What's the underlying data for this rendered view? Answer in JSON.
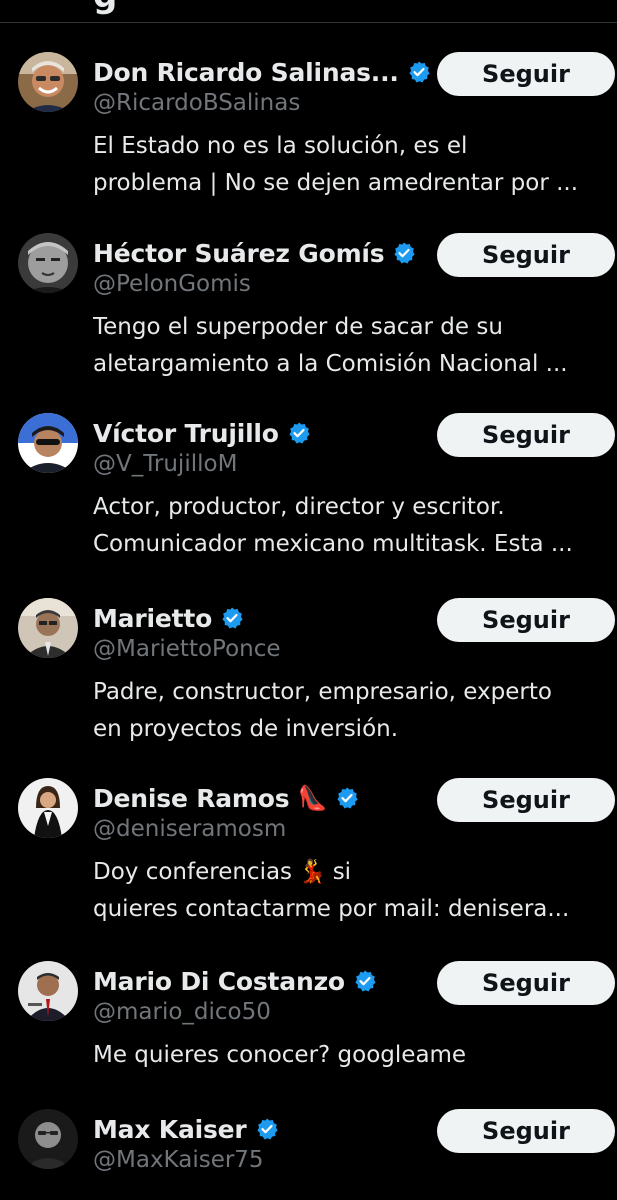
{
  "header": {
    "title_fragment": "g"
  },
  "colors": {
    "background": "#000000",
    "primary_text": "#e7e9ea",
    "secondary_text": "#71767b",
    "verified_blue": "#1d9bf0",
    "button_bg": "#eff3f4",
    "button_text": "#0f1419"
  },
  "users": [
    {
      "name": "Don Ricardo Salinas...",
      "handle": "@RicardoBSalinas",
      "verified": true,
      "button_label": "Seguir",
      "bio_lines": [
        "El Estado no es la solución, es el",
        "problema | No se dejen amedrentar por ..."
      ]
    },
    {
      "name": "Héctor Suárez Gomís",
      "handle": "@PelonGomis",
      "verified": true,
      "button_label": "Seguir",
      "bio_lines": [
        "Tengo el superpoder de sacar de su",
        "aletargamiento a la Comisión Nacional ..."
      ]
    },
    {
      "name": "Víctor Trujillo",
      "handle": "@V_TrujilloM",
      "verified": true,
      "button_label": "Seguir",
      "bio_lines": [
        "Actor, productor, director y escritor.",
        "Comunicador mexicano multitask. Esta ..."
      ]
    },
    {
      "name": "Marietto",
      "handle": "@MariettoPonce",
      "verified": true,
      "button_label": "Seguir",
      "bio_lines": [
        "Padre, constructor, empresario, experto",
        "en proyectos de inversión."
      ]
    },
    {
      "name": "Denise Ramos",
      "name_emoji": "👠",
      "handle": "@deniseramosm",
      "verified": true,
      "button_label": "Seguir",
      "bio_line1_text": "Doy conferencias",
      "bio_line1_emoji": "💃",
      "bio_line1_after": "si",
      "bio_line2": "quieres contactarme por mail: denisera..."
    },
    {
      "name": "Mario Di Costanzo",
      "handle": "@mario_dico50",
      "verified": true,
      "button_label": "Seguir",
      "bio_lines": [
        "Me quieres conocer? googleame"
      ]
    },
    {
      "name": "Max Kaiser",
      "handle": "@MaxKaiser75",
      "verified": true,
      "button_label": "Seguir",
      "bio_lines": []
    }
  ],
  "icons": {
    "verified": "verified-badge-icon",
    "avatar": "avatar"
  }
}
